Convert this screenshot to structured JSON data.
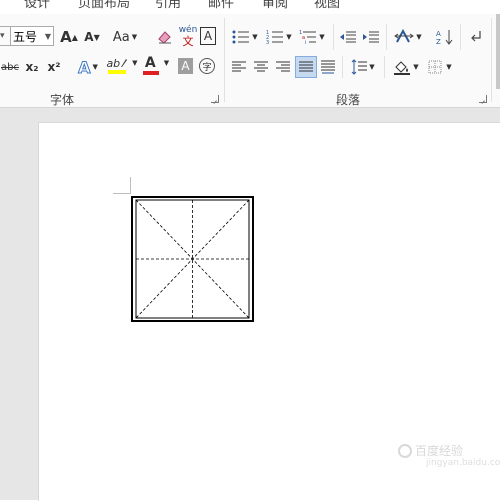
{
  "tabs": [
    "设计",
    "页面布局",
    "引用",
    "邮件",
    "审阅",
    "视图"
  ],
  "ribbon": {
    "font_group": {
      "label": "字体",
      "font_size": "五号",
      "grow_font": "A",
      "shrink_font": "A",
      "change_case": "Aa",
      "clear_format_icon": "eraser-icon",
      "phonetic_guide": "wén",
      "phonetic_guide_sub": "文",
      "char_border": "A",
      "strikethrough": "abc",
      "subscript": "x₂",
      "superscript": "x²",
      "text_effects": "A",
      "highlight": "ab",
      "font_color": "A",
      "char_shading": "A",
      "enclose_char": "字"
    },
    "paragraph_group": {
      "label": "段落"
    }
  },
  "watermark": {
    "text": "百度经验",
    "sub": "jingyan.baidu.com"
  },
  "colors": {
    "highlight_yellow": "#ffff00",
    "font_red": "#e02020",
    "active_bg": "#c5d9f1"
  }
}
